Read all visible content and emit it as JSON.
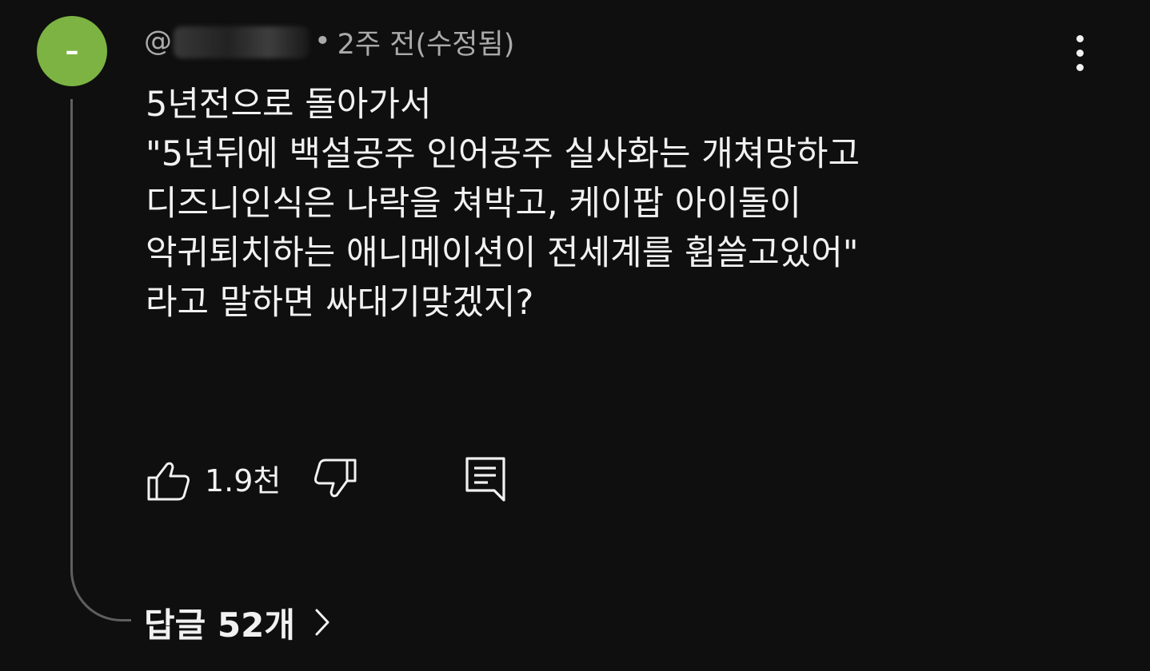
{
  "comment": {
    "avatar_glyph": "–",
    "avatar_color": "#7cb342",
    "author_prefix": "@",
    "time_ago": "2주 전(수정됨)",
    "meta_separator": "•",
    "lines": [
      "5년전으로 돌아가서",
      "\"5년뒤에 백설공주 인어공주 실사화는 개쳐망하고",
      "디즈니인식은 나락을 쳐박고, 케이팝 아이돌이",
      "악귀퇴치하는 애니메이션이 전세계를 휩쓸고있어\"",
      "라고 말하면 싸대기맞겠지?"
    ],
    "like_count": "1.9천",
    "replies_label": "답글 52개",
    "icons": {
      "like": "thumb-up-icon",
      "dislike": "thumb-down-icon",
      "reply": "comment-reply-icon",
      "more": "more-vert-icon",
      "chevron": "chevron-right-icon"
    }
  }
}
